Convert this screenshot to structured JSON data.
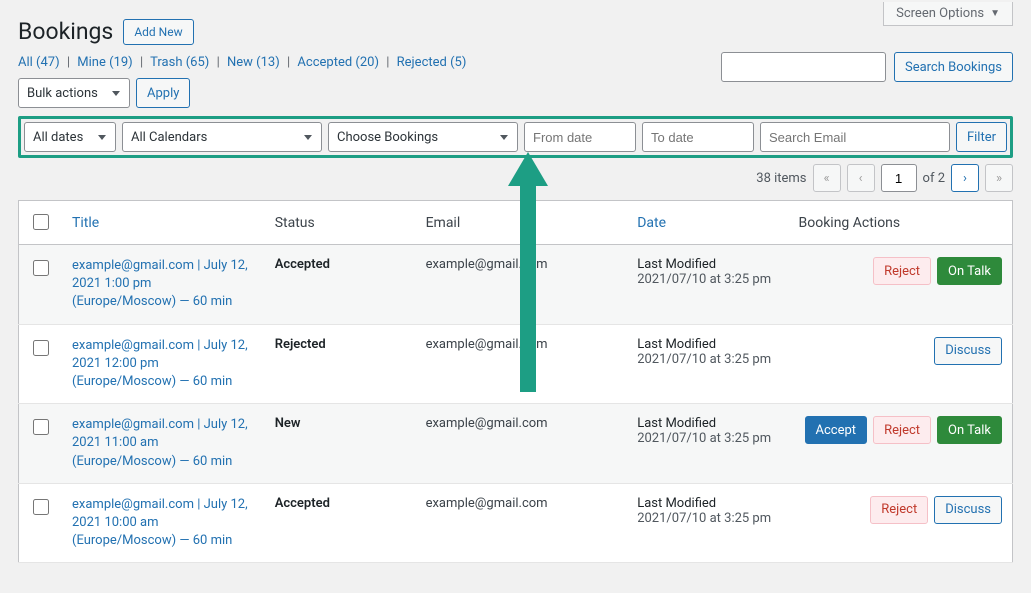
{
  "screen_options": "Screen Options",
  "page_title": "Bookings",
  "add_new": "Add New",
  "filters": {
    "all": {
      "label": "All",
      "count": "(47)"
    },
    "mine": {
      "label": "Mine",
      "count": "(19)"
    },
    "trash": {
      "label": "Trash",
      "count": "(65)"
    },
    "new": {
      "label": "New",
      "count": "(13)"
    },
    "accepted": {
      "label": "Accepted",
      "count": "(20)"
    },
    "rejected": {
      "label": "Rejected",
      "count": "(5)"
    }
  },
  "search_bookings": "Search Bookings",
  "bulk_actions": "Bulk actions",
  "apply": "Apply",
  "filter_bar": {
    "all_dates": "All dates",
    "all_calendars": "All Calendars",
    "choose_bookings": "Choose Bookings",
    "from_date": "From date",
    "to_date": "To date",
    "search_email": "Search Email",
    "filter": "Filter"
  },
  "pagination": {
    "items": "38 items",
    "current": "1",
    "of_total": "of 2"
  },
  "columns": {
    "title": "Title",
    "status": "Status",
    "email": "Email",
    "date": "Date",
    "actions": "Booking Actions"
  },
  "action_labels": {
    "accept": "Accept",
    "reject": "Reject",
    "on_talk": "On Talk",
    "discuss": "Discuss"
  },
  "date_modified_label": "Last Modified",
  "rows": [
    {
      "title": "example@gmail.com | July 12, 2021 1:00 pm (Europe/Moscow) — 60 min",
      "status": "Accepted",
      "email": "example@gmail.com",
      "date": "2021/07/10 at 3:25 pm",
      "actions": [
        "reject",
        "on_talk"
      ]
    },
    {
      "title": "example@gmail.com | July 12, 2021 12:00 pm (Europe/Moscow) — 60 min",
      "status": "Rejected",
      "email": "example@gmail.com",
      "date": "2021/07/10 at 3:25 pm",
      "actions": [
        "discuss"
      ]
    },
    {
      "title": "example@gmail.com | July 12, 2021 11:00 am (Europe/Moscow) — 60 min",
      "status": "New",
      "email": "example@gmail.com",
      "date": "2021/07/10 at 3:25 pm",
      "actions": [
        "accept",
        "reject",
        "on_talk"
      ]
    },
    {
      "title": "example@gmail.com | July 12, 2021 10:00 am (Europe/Moscow) — 60 min",
      "status": "Accepted",
      "email": "example@gmail.com",
      "date": "2021/07/10 at 3:25 pm",
      "actions": [
        "reject",
        "discuss"
      ]
    }
  ]
}
